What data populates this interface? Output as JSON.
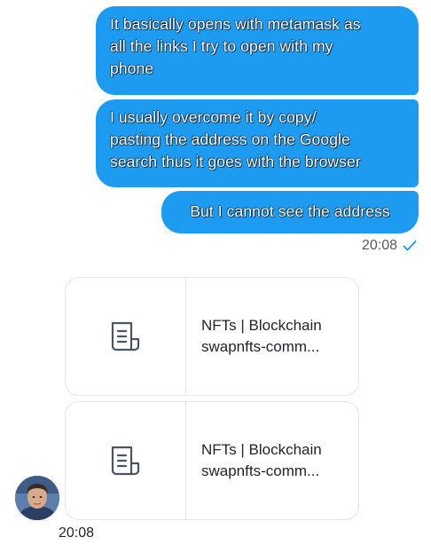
{
  "messages": {
    "sent": [
      {
        "lines": [
          "It basically opens with metamask as",
          "all the links I try to open with my",
          "phone"
        ]
      },
      {
        "lines": [
          "I usually overcome it by copy/",
          "pasting the address on the Google",
          "search thus it goes with the browser"
        ]
      },
      {
        "lines": [
          "But I cannot see the address"
        ]
      }
    ],
    "sent_time": "20:08",
    "sent_status_icon": "check-icon"
  },
  "link_cards": [
    {
      "title": "NFTs | Blockchain",
      "domain": "swapnfts-comm...",
      "icon": "document-icon"
    },
    {
      "title": "NFTs | Blockchain",
      "domain": "swapnfts-comm...",
      "icon": "document-icon"
    }
  ],
  "received": {
    "time": "20:08",
    "avatar": "avatar"
  },
  "colors": {
    "bubble": "#1d9bf0",
    "check": "#1d9bf0",
    "card_border": "#e3e6e8",
    "icon": "#4a5560"
  }
}
